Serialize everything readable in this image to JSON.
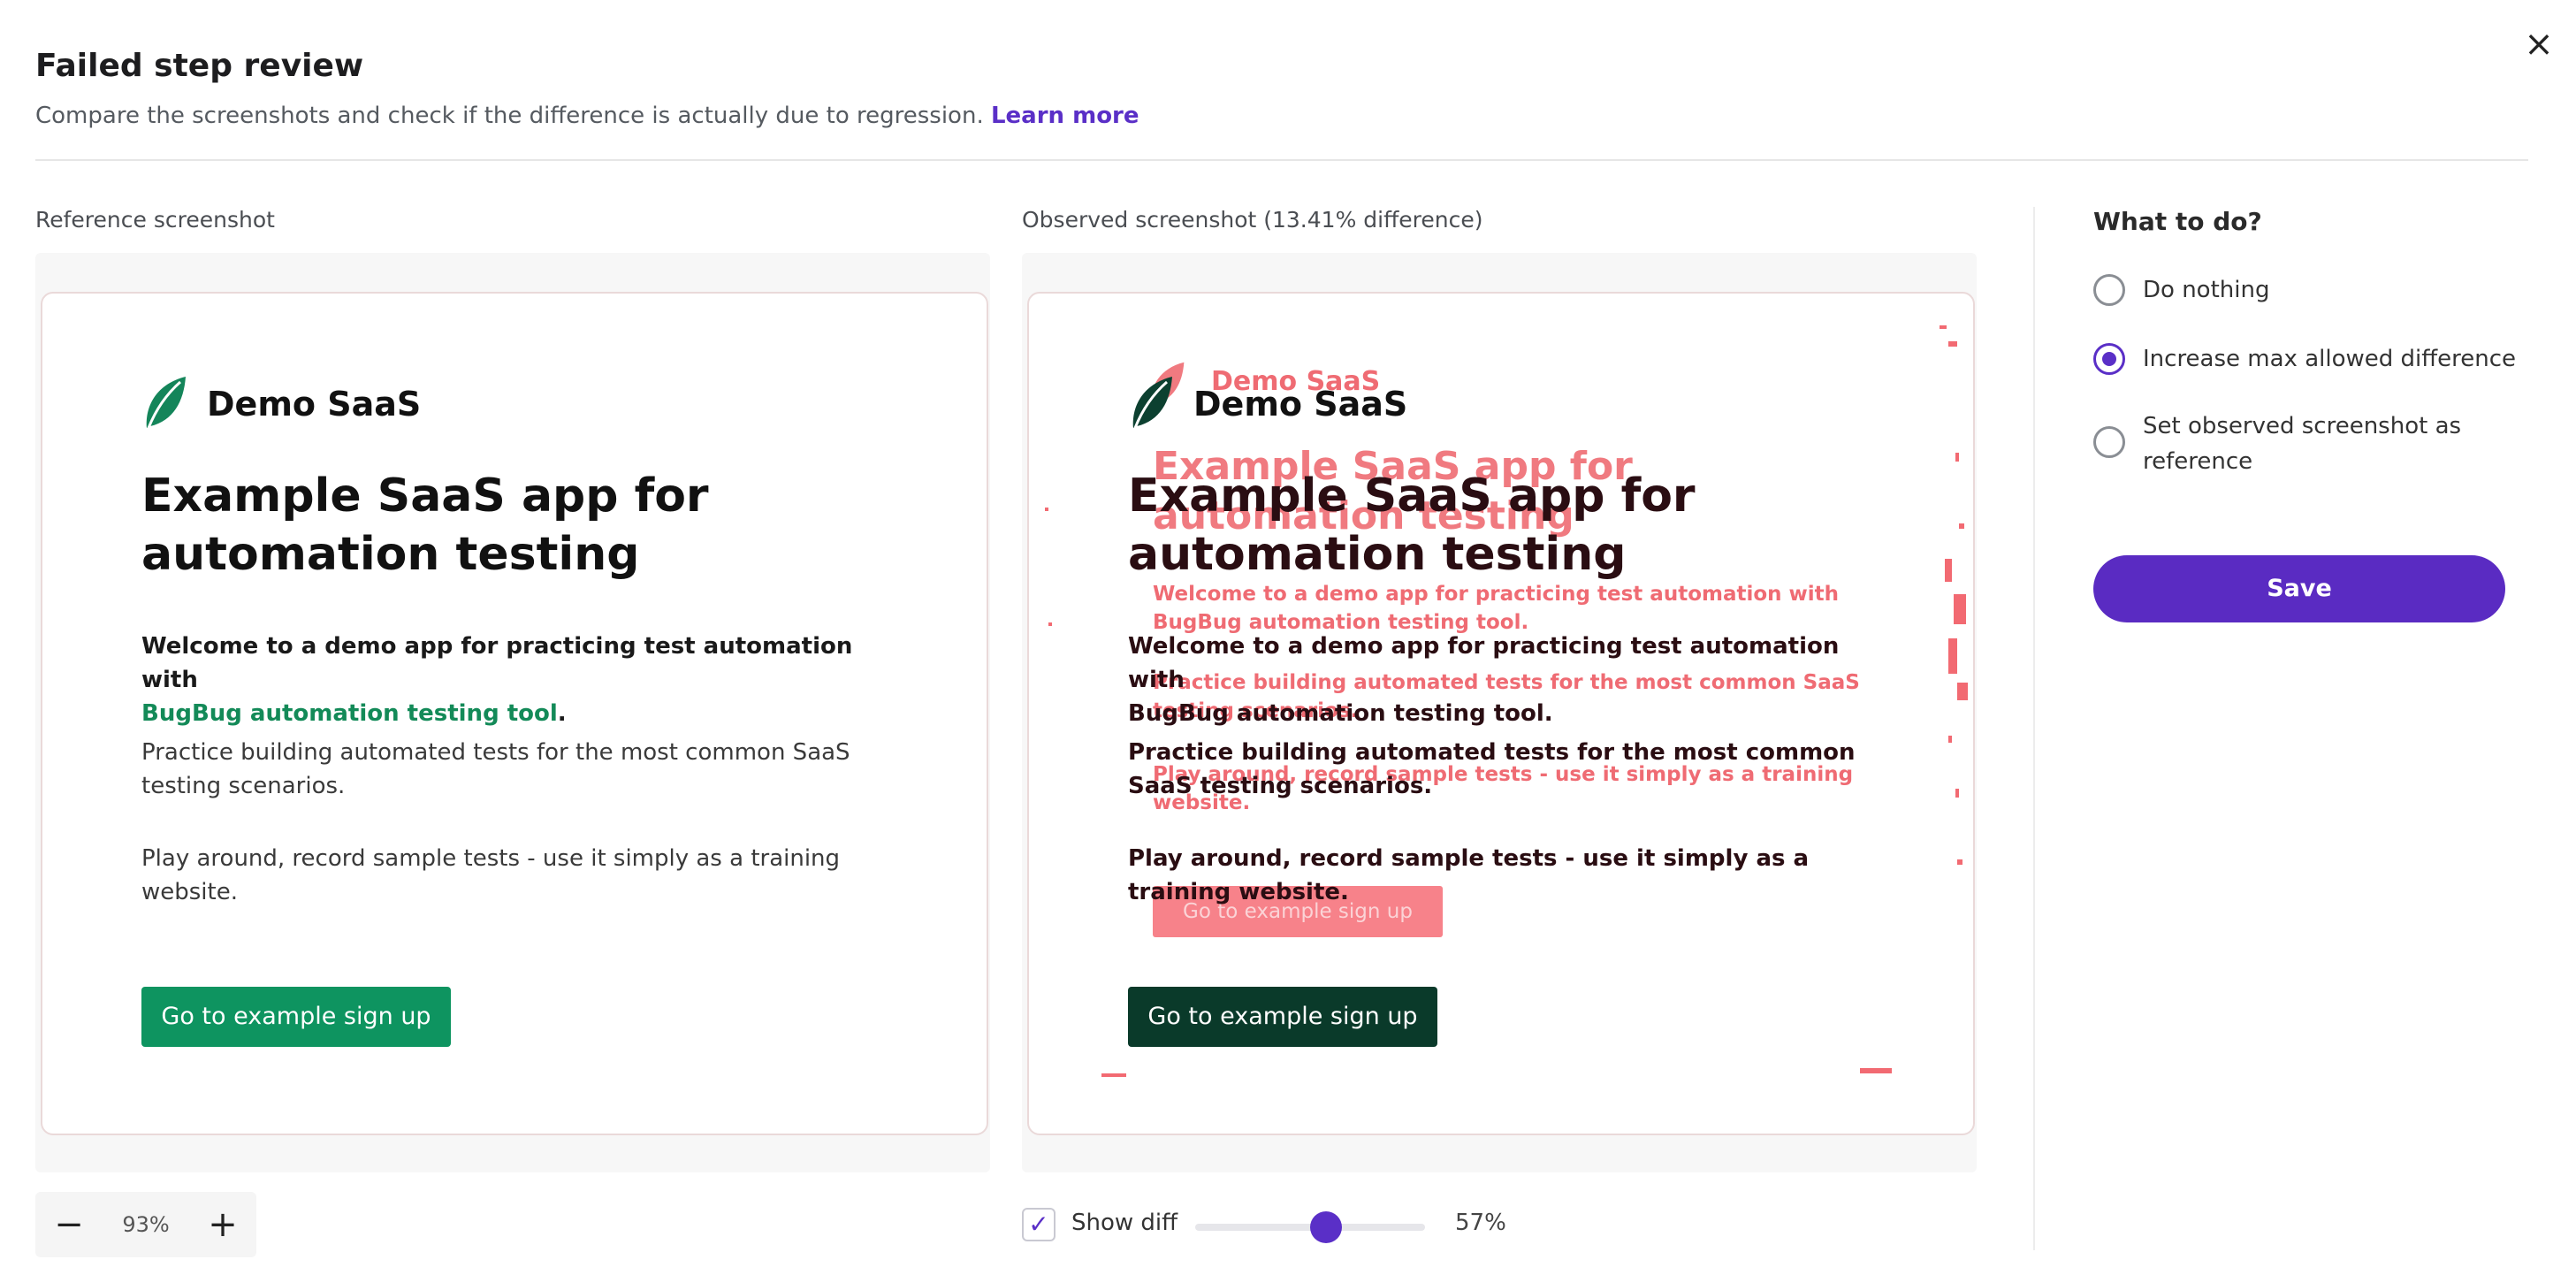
{
  "dialog": {
    "title": "Failed step review",
    "subtitle": "Compare the screenshots and check if the difference is actually due to regression.",
    "learn_more": "Learn more",
    "close_icon": "×"
  },
  "reference": {
    "label": "Reference screenshot",
    "app": {
      "logo_text": "Demo SaaS",
      "heading": "Example SaaS app for automation testing",
      "intro": "Welcome to a demo app for practicing test automation with",
      "intro_link": "BugBug automation testing tool",
      "intro_end": ".",
      "para1": "Practice building automated tests for the most common SaaS testing scenarios.",
      "para2": "Play around, record sample tests - use it simply as a training website.",
      "cta": "Go to example sign up"
    }
  },
  "observed": {
    "label": "Observed screenshot (13.41% difference)",
    "app": {
      "logo_text": "Demo SaaS",
      "heading": "Example SaaS app for automation testing",
      "intro": "Welcome to a demo app for practicing test automation with",
      "intro_link": "BugBug automation testing tool",
      "intro_end": ".",
      "para1": "Practice building automated tests for the most common SaaS testing scenarios.",
      "para2": "Play around, record sample tests - use it simply as a training website.",
      "cta": "Go to example sign up"
    }
  },
  "actions": {
    "heading": "What to do?",
    "options": [
      {
        "label": "Do nothing",
        "selected": false
      },
      {
        "label": "Increase max allowed difference",
        "selected": true
      },
      {
        "label": "Set observed screenshot as reference",
        "selected": false
      }
    ],
    "save": "Save",
    "accent": "#5a2fc7"
  },
  "controls": {
    "zoom_out_icon": "−",
    "zoom_value": "93%",
    "zoom_in_icon": "+",
    "show_diff_label": "Show diff",
    "show_diff_checked": true,
    "check_icon": "✓",
    "diff_opacity": "57%"
  }
}
